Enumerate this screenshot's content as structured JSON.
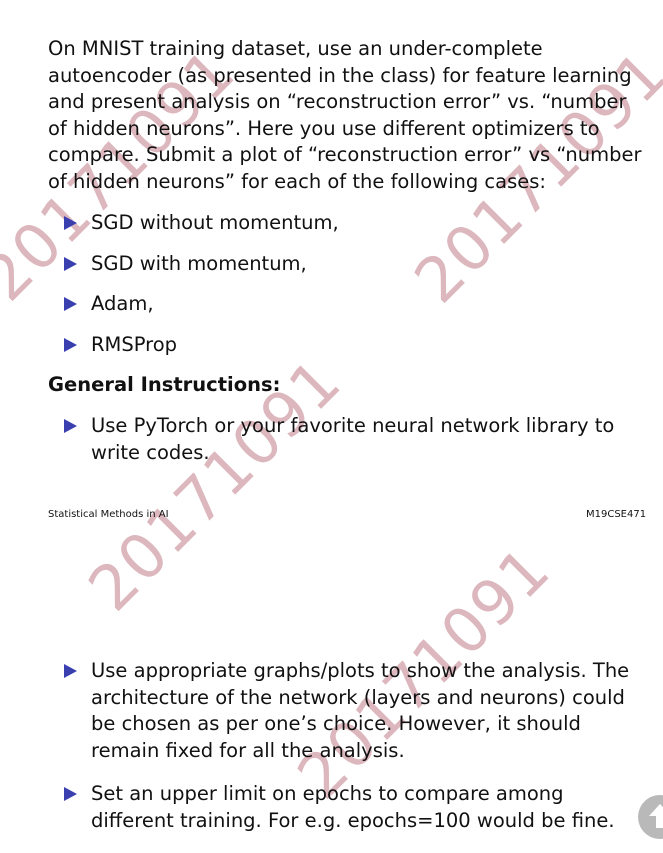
{
  "slide1": {
    "intro": "On MNIST training dataset, use an under-complete autoencoder (as presented in the class) for feature learning and present analysis on “reconstruction error” vs. “number of hidden neurons”. Here you use different optimizers to compare. Submit a plot of “reconstruction error” vs “number of hidden neurons” for each of the following cases:",
    "optimizers": [
      "SGD without momentum,",
      "SGD with momentum,",
      "Adam,",
      "RMSProp"
    ],
    "instructions_heading": "General Instructions:",
    "instruction_1": "Use PyTorch or your favorite neural network library to write codes.",
    "footer_left": "Statistical Methods in AI",
    "footer_right": "M19CSE471"
  },
  "slide2": {
    "instructions": [
      "Use appropriate graphs/plots to show the analysis. The architecture of the network (layers and neurons) could be chosen as per one’s choice. However, it should remain fixed for all the analysis.",
      "Set an upper limit on epochs to compare among different training. For e.g. epochs=100 would be fine."
    ]
  },
  "watermark": {
    "text": "20171091",
    "color": "#dcb7bd"
  },
  "bullet_color": "#3a3fb0",
  "scroll_button_icon": "arrow-up-icon"
}
